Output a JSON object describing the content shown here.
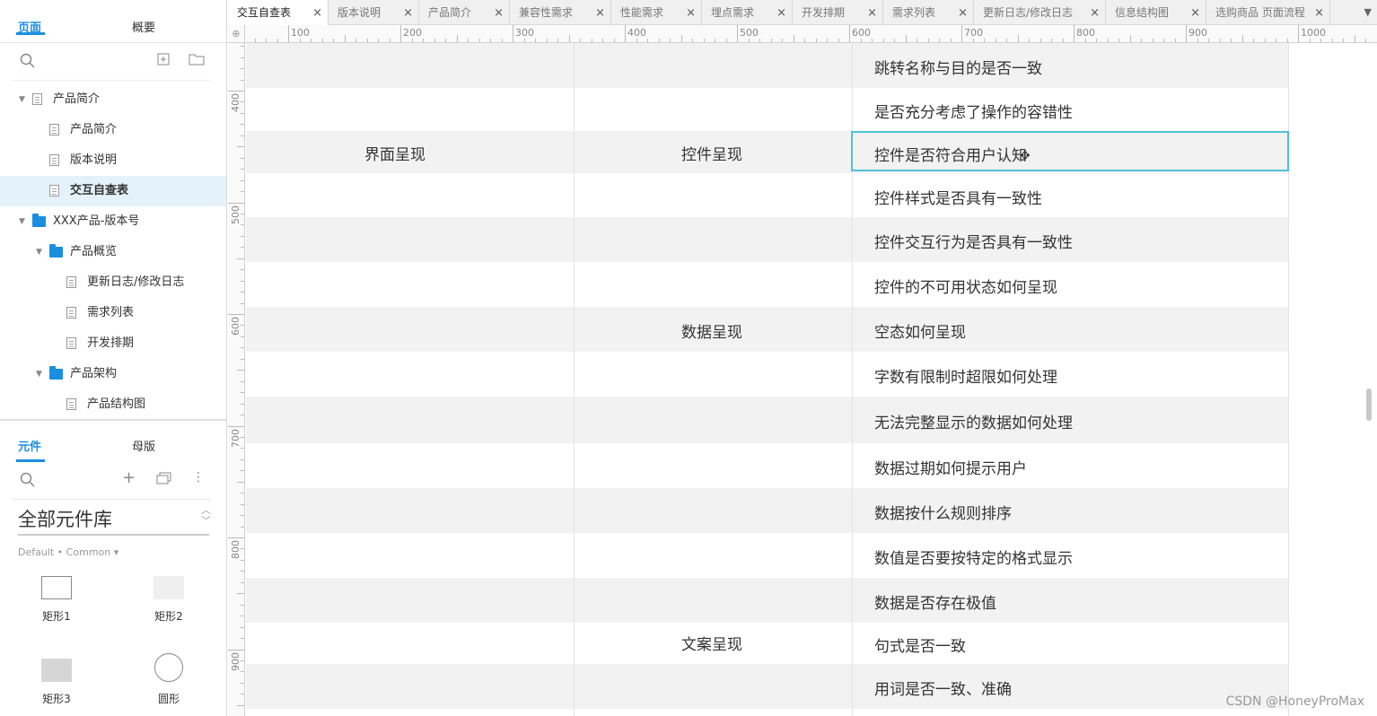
{
  "left_panel": {
    "tabs": [
      "页面",
      "概要"
    ],
    "tree": [
      {
        "label": "产品简介",
        "kind": "page",
        "depth": 0,
        "expand": true
      },
      {
        "label": "产品简介",
        "kind": "page",
        "depth": 1
      },
      {
        "label": "版本说明",
        "kind": "page",
        "depth": 1
      },
      {
        "label": "交互自查表",
        "kind": "page",
        "depth": 1,
        "selected": true
      },
      {
        "label": "XXX产品-版本号",
        "kind": "folder",
        "depth": 0,
        "expand": true
      },
      {
        "label": "产品概览",
        "kind": "folder",
        "depth": 1,
        "expand": true
      },
      {
        "label": "更新日志/修改日志",
        "kind": "page",
        "depth": 2
      },
      {
        "label": "需求列表",
        "kind": "page",
        "depth": 2
      },
      {
        "label": "开发排期",
        "kind": "page",
        "depth": 2
      },
      {
        "label": "产品架构",
        "kind": "folder",
        "depth": 1,
        "expand": true
      },
      {
        "label": "产品结构图",
        "kind": "page",
        "depth": 2
      }
    ],
    "component_tabs": [
      "元件",
      "母版"
    ],
    "library": "全部元件库",
    "library_sub": "Default • Common ▾",
    "widgets": [
      "矩形1",
      "矩形2",
      "矩形3",
      "圆形"
    ]
  },
  "tabs": [
    {
      "label": "交互自查表",
      "active": true
    },
    {
      "label": "版本说明"
    },
    {
      "label": "产品简介"
    },
    {
      "label": "兼容性需求"
    },
    {
      "label": "性能需求"
    },
    {
      "label": "埋点需求"
    },
    {
      "label": "开发排期"
    },
    {
      "label": "需求列表"
    },
    {
      "label": "更新日志/修改日志"
    },
    {
      "label": "信息结构图"
    },
    {
      "label": "选购商品 页面流程"
    }
  ],
  "ruler": {
    "h_labels": [
      "100",
      "200",
      "300",
      "400",
      "500",
      "600",
      "700",
      "800",
      "900",
      "1000"
    ],
    "v_labels": [
      "400",
      "500",
      "600",
      "700",
      "800",
      "900"
    ]
  },
  "table": {
    "category1": "界面呈现",
    "groups": [
      {
        "label": "控件呈现"
      },
      {
        "label": "数据呈现"
      },
      {
        "label": "文案呈现"
      }
    ],
    "items": [
      "跳转名称与目的是否一致",
      "是否充分考虑了操作的容错性",
      "控件是否符合用户认知",
      "控件样式是否具有一致性",
      "控件交互行为是否具有一致性",
      "控件的不可用状态如何呈现",
      "空态如何呈现",
      "字数有限制时超限如何处理",
      "无法完整显示的数据如何处理",
      "数据过期如何提示用户",
      "数据按什么规则排序",
      "数值是否要按特定的格式显示",
      "数据是否存在极值",
      "句式是否一致",
      "用词是否一致、准确"
    ]
  },
  "watermark": "CSDN @HoneyProMax"
}
